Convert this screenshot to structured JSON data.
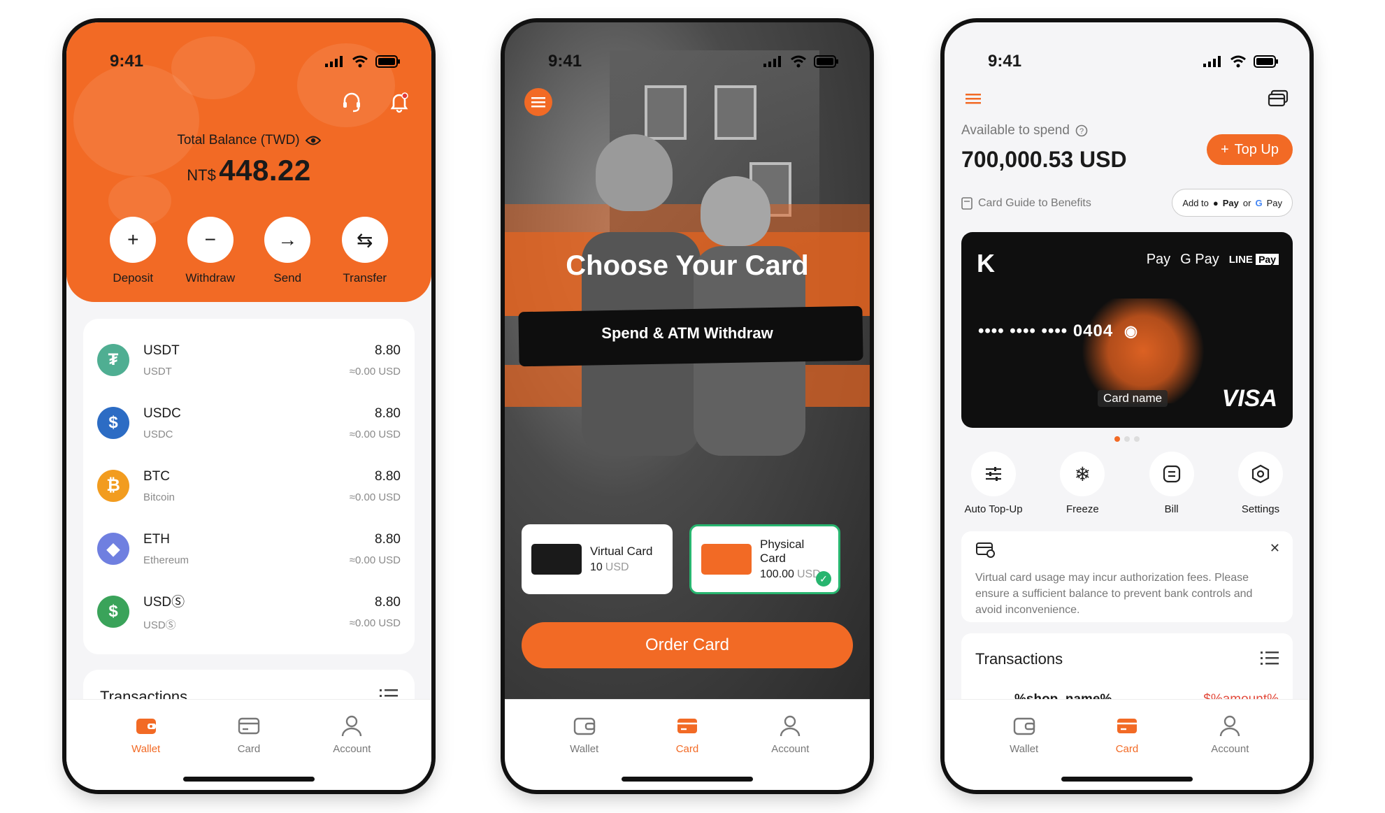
{
  "status_time": "9:41",
  "colors": {
    "accent": "#f26a25",
    "success": "#27b56f",
    "negative": "#e24a3b"
  },
  "tabs": [
    "Wallet",
    "Card",
    "Account"
  ],
  "wallet_screen": {
    "balance_label": "Total Balance (TWD)",
    "balance_currency": "NT$",
    "balance_amount": "448.22",
    "actions": [
      "Deposit",
      "Withdraw",
      "Send",
      "Transfer"
    ],
    "coins": [
      {
        "symbol": "USDT",
        "name": "USDT",
        "amount": "8.80",
        "usd": "≈0.00 USD",
        "color": "#4fae92",
        "icon": "tether-icon"
      },
      {
        "symbol": "USDC",
        "name": "USDC",
        "amount": "8.80",
        "usd": "≈0.00 USD",
        "color": "#2c6cc4",
        "icon": "usdc-icon"
      },
      {
        "symbol": "BTC",
        "name": "Bitcoin",
        "amount": "8.80",
        "usd": "≈0.00 USD",
        "color": "#f29c1f",
        "icon": "bitcoin-icon"
      },
      {
        "symbol": "ETH",
        "name": "Ethereum",
        "amount": "8.80",
        "usd": "≈0.00 USD",
        "color": "#6f7fe0",
        "icon": "ethereum-icon"
      },
      {
        "symbol": "USDⓈ",
        "name": "USDⓈ",
        "amount": "8.80",
        "usd": "≈0.00 USD",
        "color": "#3aa35a",
        "icon": "dollar-icon"
      }
    ],
    "transactions_title": "Transactions"
  },
  "choose_screen": {
    "title": "Choose Your Card",
    "subtitle": "Spend & ATM Withdraw",
    "virtual": {
      "name": "Virtual Card",
      "price": "10",
      "unit": "USD"
    },
    "physical": {
      "name": "Physical Card",
      "price": "100.00",
      "unit": "USD"
    },
    "order_button": "Order Card"
  },
  "card_screen": {
    "available_label": "Available to spend",
    "available_amount": "700,000.53 USD",
    "topup_label": "Top Up",
    "guide_label": "Card Guide to Benefits",
    "add_to": "Add to",
    "apple_pay": "Pay",
    "or": "or",
    "google_pay": "Pay",
    "card_number": "••••  ••••  •••• 0404",
    "card_name": "Card name",
    "card_wallets": [
      "Pay",
      "G Pay",
      "LINE",
      "Pay"
    ],
    "card_network": "VISA",
    "actions": [
      "Auto Top-Up",
      "Freeze",
      "Bill",
      "Settings"
    ],
    "notice": "Virtual card usage may incur authorization fees. Please ensure a sufficient balance to prevent bank controls and avoid inconvenience.",
    "transactions_title": "Transactions",
    "tx_shop": "%shop_name%",
    "tx_amount": "-$%amount%"
  }
}
